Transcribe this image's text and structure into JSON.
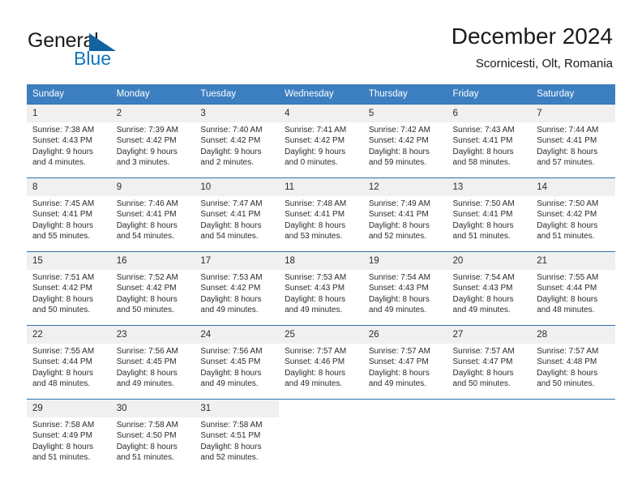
{
  "brand": {
    "name_part1": "General",
    "name_part2": "Blue",
    "accent_color": "#1175bb",
    "triangle_color": "#12639f"
  },
  "header": {
    "title": "December 2024",
    "subtitle": "Scornicesti, Olt, Romania"
  },
  "calendar": {
    "header_bg": "#3c7fc0",
    "row_border": "#2f6fae",
    "daynum_bg": "#f0f0f0",
    "weekdays": [
      "Sunday",
      "Monday",
      "Tuesday",
      "Wednesday",
      "Thursday",
      "Friday",
      "Saturday"
    ],
    "weeks": [
      [
        {
          "day": "1",
          "sunrise": "Sunrise: 7:38 AM",
          "sunset": "Sunset: 4:43 PM",
          "daylight1": "Daylight: 9 hours",
          "daylight2": "and 4 minutes."
        },
        {
          "day": "2",
          "sunrise": "Sunrise: 7:39 AM",
          "sunset": "Sunset: 4:42 PM",
          "daylight1": "Daylight: 9 hours",
          "daylight2": "and 3 minutes."
        },
        {
          "day": "3",
          "sunrise": "Sunrise: 7:40 AM",
          "sunset": "Sunset: 4:42 PM",
          "daylight1": "Daylight: 9 hours",
          "daylight2": "and 2 minutes."
        },
        {
          "day": "4",
          "sunrise": "Sunrise: 7:41 AM",
          "sunset": "Sunset: 4:42 PM",
          "daylight1": "Daylight: 9 hours",
          "daylight2": "and 0 minutes."
        },
        {
          "day": "5",
          "sunrise": "Sunrise: 7:42 AM",
          "sunset": "Sunset: 4:42 PM",
          "daylight1": "Daylight: 8 hours",
          "daylight2": "and 59 minutes."
        },
        {
          "day": "6",
          "sunrise": "Sunrise: 7:43 AM",
          "sunset": "Sunset: 4:41 PM",
          "daylight1": "Daylight: 8 hours",
          "daylight2": "and 58 minutes."
        },
        {
          "day": "7",
          "sunrise": "Sunrise: 7:44 AM",
          "sunset": "Sunset: 4:41 PM",
          "daylight1": "Daylight: 8 hours",
          "daylight2": "and 57 minutes."
        }
      ],
      [
        {
          "day": "8",
          "sunrise": "Sunrise: 7:45 AM",
          "sunset": "Sunset: 4:41 PM",
          "daylight1": "Daylight: 8 hours",
          "daylight2": "and 55 minutes."
        },
        {
          "day": "9",
          "sunrise": "Sunrise: 7:46 AM",
          "sunset": "Sunset: 4:41 PM",
          "daylight1": "Daylight: 8 hours",
          "daylight2": "and 54 minutes."
        },
        {
          "day": "10",
          "sunrise": "Sunrise: 7:47 AM",
          "sunset": "Sunset: 4:41 PM",
          "daylight1": "Daylight: 8 hours",
          "daylight2": "and 54 minutes."
        },
        {
          "day": "11",
          "sunrise": "Sunrise: 7:48 AM",
          "sunset": "Sunset: 4:41 PM",
          "daylight1": "Daylight: 8 hours",
          "daylight2": "and 53 minutes."
        },
        {
          "day": "12",
          "sunrise": "Sunrise: 7:49 AM",
          "sunset": "Sunset: 4:41 PM",
          "daylight1": "Daylight: 8 hours",
          "daylight2": "and 52 minutes."
        },
        {
          "day": "13",
          "sunrise": "Sunrise: 7:50 AM",
          "sunset": "Sunset: 4:41 PM",
          "daylight1": "Daylight: 8 hours",
          "daylight2": "and 51 minutes."
        },
        {
          "day": "14",
          "sunrise": "Sunrise: 7:50 AM",
          "sunset": "Sunset: 4:42 PM",
          "daylight1": "Daylight: 8 hours",
          "daylight2": "and 51 minutes."
        }
      ],
      [
        {
          "day": "15",
          "sunrise": "Sunrise: 7:51 AM",
          "sunset": "Sunset: 4:42 PM",
          "daylight1": "Daylight: 8 hours",
          "daylight2": "and 50 minutes."
        },
        {
          "day": "16",
          "sunrise": "Sunrise: 7:52 AM",
          "sunset": "Sunset: 4:42 PM",
          "daylight1": "Daylight: 8 hours",
          "daylight2": "and 50 minutes."
        },
        {
          "day": "17",
          "sunrise": "Sunrise: 7:53 AM",
          "sunset": "Sunset: 4:42 PM",
          "daylight1": "Daylight: 8 hours",
          "daylight2": "and 49 minutes."
        },
        {
          "day": "18",
          "sunrise": "Sunrise: 7:53 AM",
          "sunset": "Sunset: 4:43 PM",
          "daylight1": "Daylight: 8 hours",
          "daylight2": "and 49 minutes."
        },
        {
          "day": "19",
          "sunrise": "Sunrise: 7:54 AM",
          "sunset": "Sunset: 4:43 PM",
          "daylight1": "Daylight: 8 hours",
          "daylight2": "and 49 minutes."
        },
        {
          "day": "20",
          "sunrise": "Sunrise: 7:54 AM",
          "sunset": "Sunset: 4:43 PM",
          "daylight1": "Daylight: 8 hours",
          "daylight2": "and 49 minutes."
        },
        {
          "day": "21",
          "sunrise": "Sunrise: 7:55 AM",
          "sunset": "Sunset: 4:44 PM",
          "daylight1": "Daylight: 8 hours",
          "daylight2": "and 48 minutes."
        }
      ],
      [
        {
          "day": "22",
          "sunrise": "Sunrise: 7:55 AM",
          "sunset": "Sunset: 4:44 PM",
          "daylight1": "Daylight: 8 hours",
          "daylight2": "and 48 minutes."
        },
        {
          "day": "23",
          "sunrise": "Sunrise: 7:56 AM",
          "sunset": "Sunset: 4:45 PM",
          "daylight1": "Daylight: 8 hours",
          "daylight2": "and 49 minutes."
        },
        {
          "day": "24",
          "sunrise": "Sunrise: 7:56 AM",
          "sunset": "Sunset: 4:45 PM",
          "daylight1": "Daylight: 8 hours",
          "daylight2": "and 49 minutes."
        },
        {
          "day": "25",
          "sunrise": "Sunrise: 7:57 AM",
          "sunset": "Sunset: 4:46 PM",
          "daylight1": "Daylight: 8 hours",
          "daylight2": "and 49 minutes."
        },
        {
          "day": "26",
          "sunrise": "Sunrise: 7:57 AM",
          "sunset": "Sunset: 4:47 PM",
          "daylight1": "Daylight: 8 hours",
          "daylight2": "and 49 minutes."
        },
        {
          "day": "27",
          "sunrise": "Sunrise: 7:57 AM",
          "sunset": "Sunset: 4:47 PM",
          "daylight1": "Daylight: 8 hours",
          "daylight2": "and 50 minutes."
        },
        {
          "day": "28",
          "sunrise": "Sunrise: 7:57 AM",
          "sunset": "Sunset: 4:48 PM",
          "daylight1": "Daylight: 8 hours",
          "daylight2": "and 50 minutes."
        }
      ],
      [
        {
          "day": "29",
          "sunrise": "Sunrise: 7:58 AM",
          "sunset": "Sunset: 4:49 PM",
          "daylight1": "Daylight: 8 hours",
          "daylight2": "and 51 minutes."
        },
        {
          "day": "30",
          "sunrise": "Sunrise: 7:58 AM",
          "sunset": "Sunset: 4:50 PM",
          "daylight1": "Daylight: 8 hours",
          "daylight2": "and 51 minutes."
        },
        {
          "day": "31",
          "sunrise": "Sunrise: 7:58 AM",
          "sunset": "Sunset: 4:51 PM",
          "daylight1": "Daylight: 8 hours",
          "daylight2": "and 52 minutes."
        },
        {
          "day": "",
          "sunrise": "",
          "sunset": "",
          "daylight1": "",
          "daylight2": ""
        },
        {
          "day": "",
          "sunrise": "",
          "sunset": "",
          "daylight1": "",
          "daylight2": ""
        },
        {
          "day": "",
          "sunrise": "",
          "sunset": "",
          "daylight1": "",
          "daylight2": ""
        },
        {
          "day": "",
          "sunrise": "",
          "sunset": "",
          "daylight1": "",
          "daylight2": ""
        }
      ]
    ]
  }
}
